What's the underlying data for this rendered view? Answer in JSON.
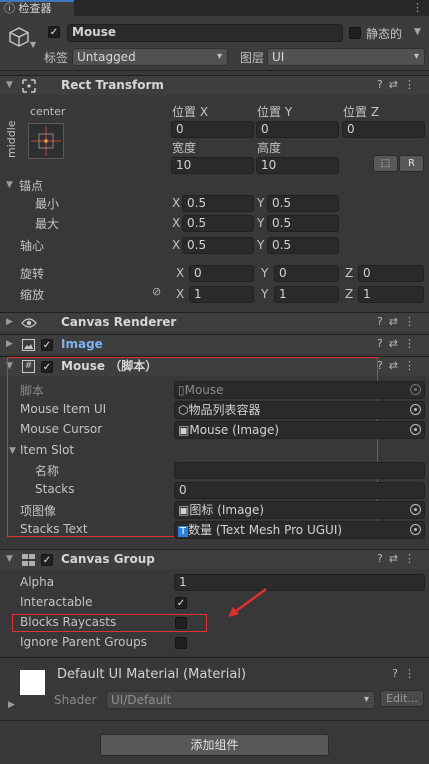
{
  "tab": {
    "title": "检查器"
  },
  "header": {
    "object_name": "Mouse",
    "static_label": "静态的",
    "tag_label": "标签",
    "tag_value": "Untagged",
    "layer_label": "图层",
    "layer_value": "UI"
  },
  "rect_transform": {
    "title": "Rect Transform",
    "anchor_h": "center",
    "anchor_v": "middle",
    "pos_x_label": "位置 X",
    "pos_x": "0",
    "pos_y_label": "位置 Y",
    "pos_y": "0",
    "pos_z_label": "位置 Z",
    "pos_z": "0",
    "width_label": "宽度",
    "width": "10",
    "height_label": "高度",
    "height": "10",
    "r_button": "R",
    "anchors_label": "锚点",
    "min_label": "最小",
    "min_x": "0.5",
    "min_y": "0.5",
    "max_label": "最大",
    "max_x": "0.5",
    "max_y": "0.5",
    "pivot_label": "轴心",
    "pivot_x": "0.5",
    "pivot_y": "0.5",
    "rotation_label": "旋转",
    "rot_x": "0",
    "rot_y": "0",
    "rot_z": "0",
    "scale_label": "缩放",
    "scale_x": "1",
    "scale_y": "1",
    "scale_z": "1",
    "x": "X",
    "y": "Y",
    "z": "Z"
  },
  "canvas_renderer": {
    "title": "Canvas Renderer"
  },
  "image": {
    "title": "Image"
  },
  "mouse_script": {
    "title": "Mouse （脚本）",
    "script_label": "脚本",
    "script_value": "Mouse",
    "item_ui_label": "Mouse Item UI",
    "item_ui_value": "物品列表容器",
    "cursor_label": "Mouse Cursor",
    "cursor_value": "Mouse (Image)",
    "item_slot_label": "Item Slot",
    "name_label": "名称",
    "name_value": "",
    "stacks_label": "Stacks",
    "stacks_value": "0",
    "image_label": "项图像",
    "image_value": "图标 (Image)",
    "stacks_text_label": "Stacks Text",
    "stacks_text_value": "数量 (Text Mesh Pro UGUI)"
  },
  "canvas_group": {
    "title": "Canvas Group",
    "alpha_label": "Alpha",
    "alpha_value": "1",
    "interactable_label": "Interactable",
    "blocks_label": "Blocks Raycasts",
    "ignore_label": "Ignore Parent Groups"
  },
  "material": {
    "title": "Default UI Material (Material)",
    "shader_label": "Shader",
    "shader_value": "UI/Default",
    "edit_button": "Edit..."
  },
  "add_component": "添加组件",
  "colors": {
    "accent": "#3a79bb",
    "highlight": "#e0302f",
    "image_title": "#7fb2f0"
  }
}
